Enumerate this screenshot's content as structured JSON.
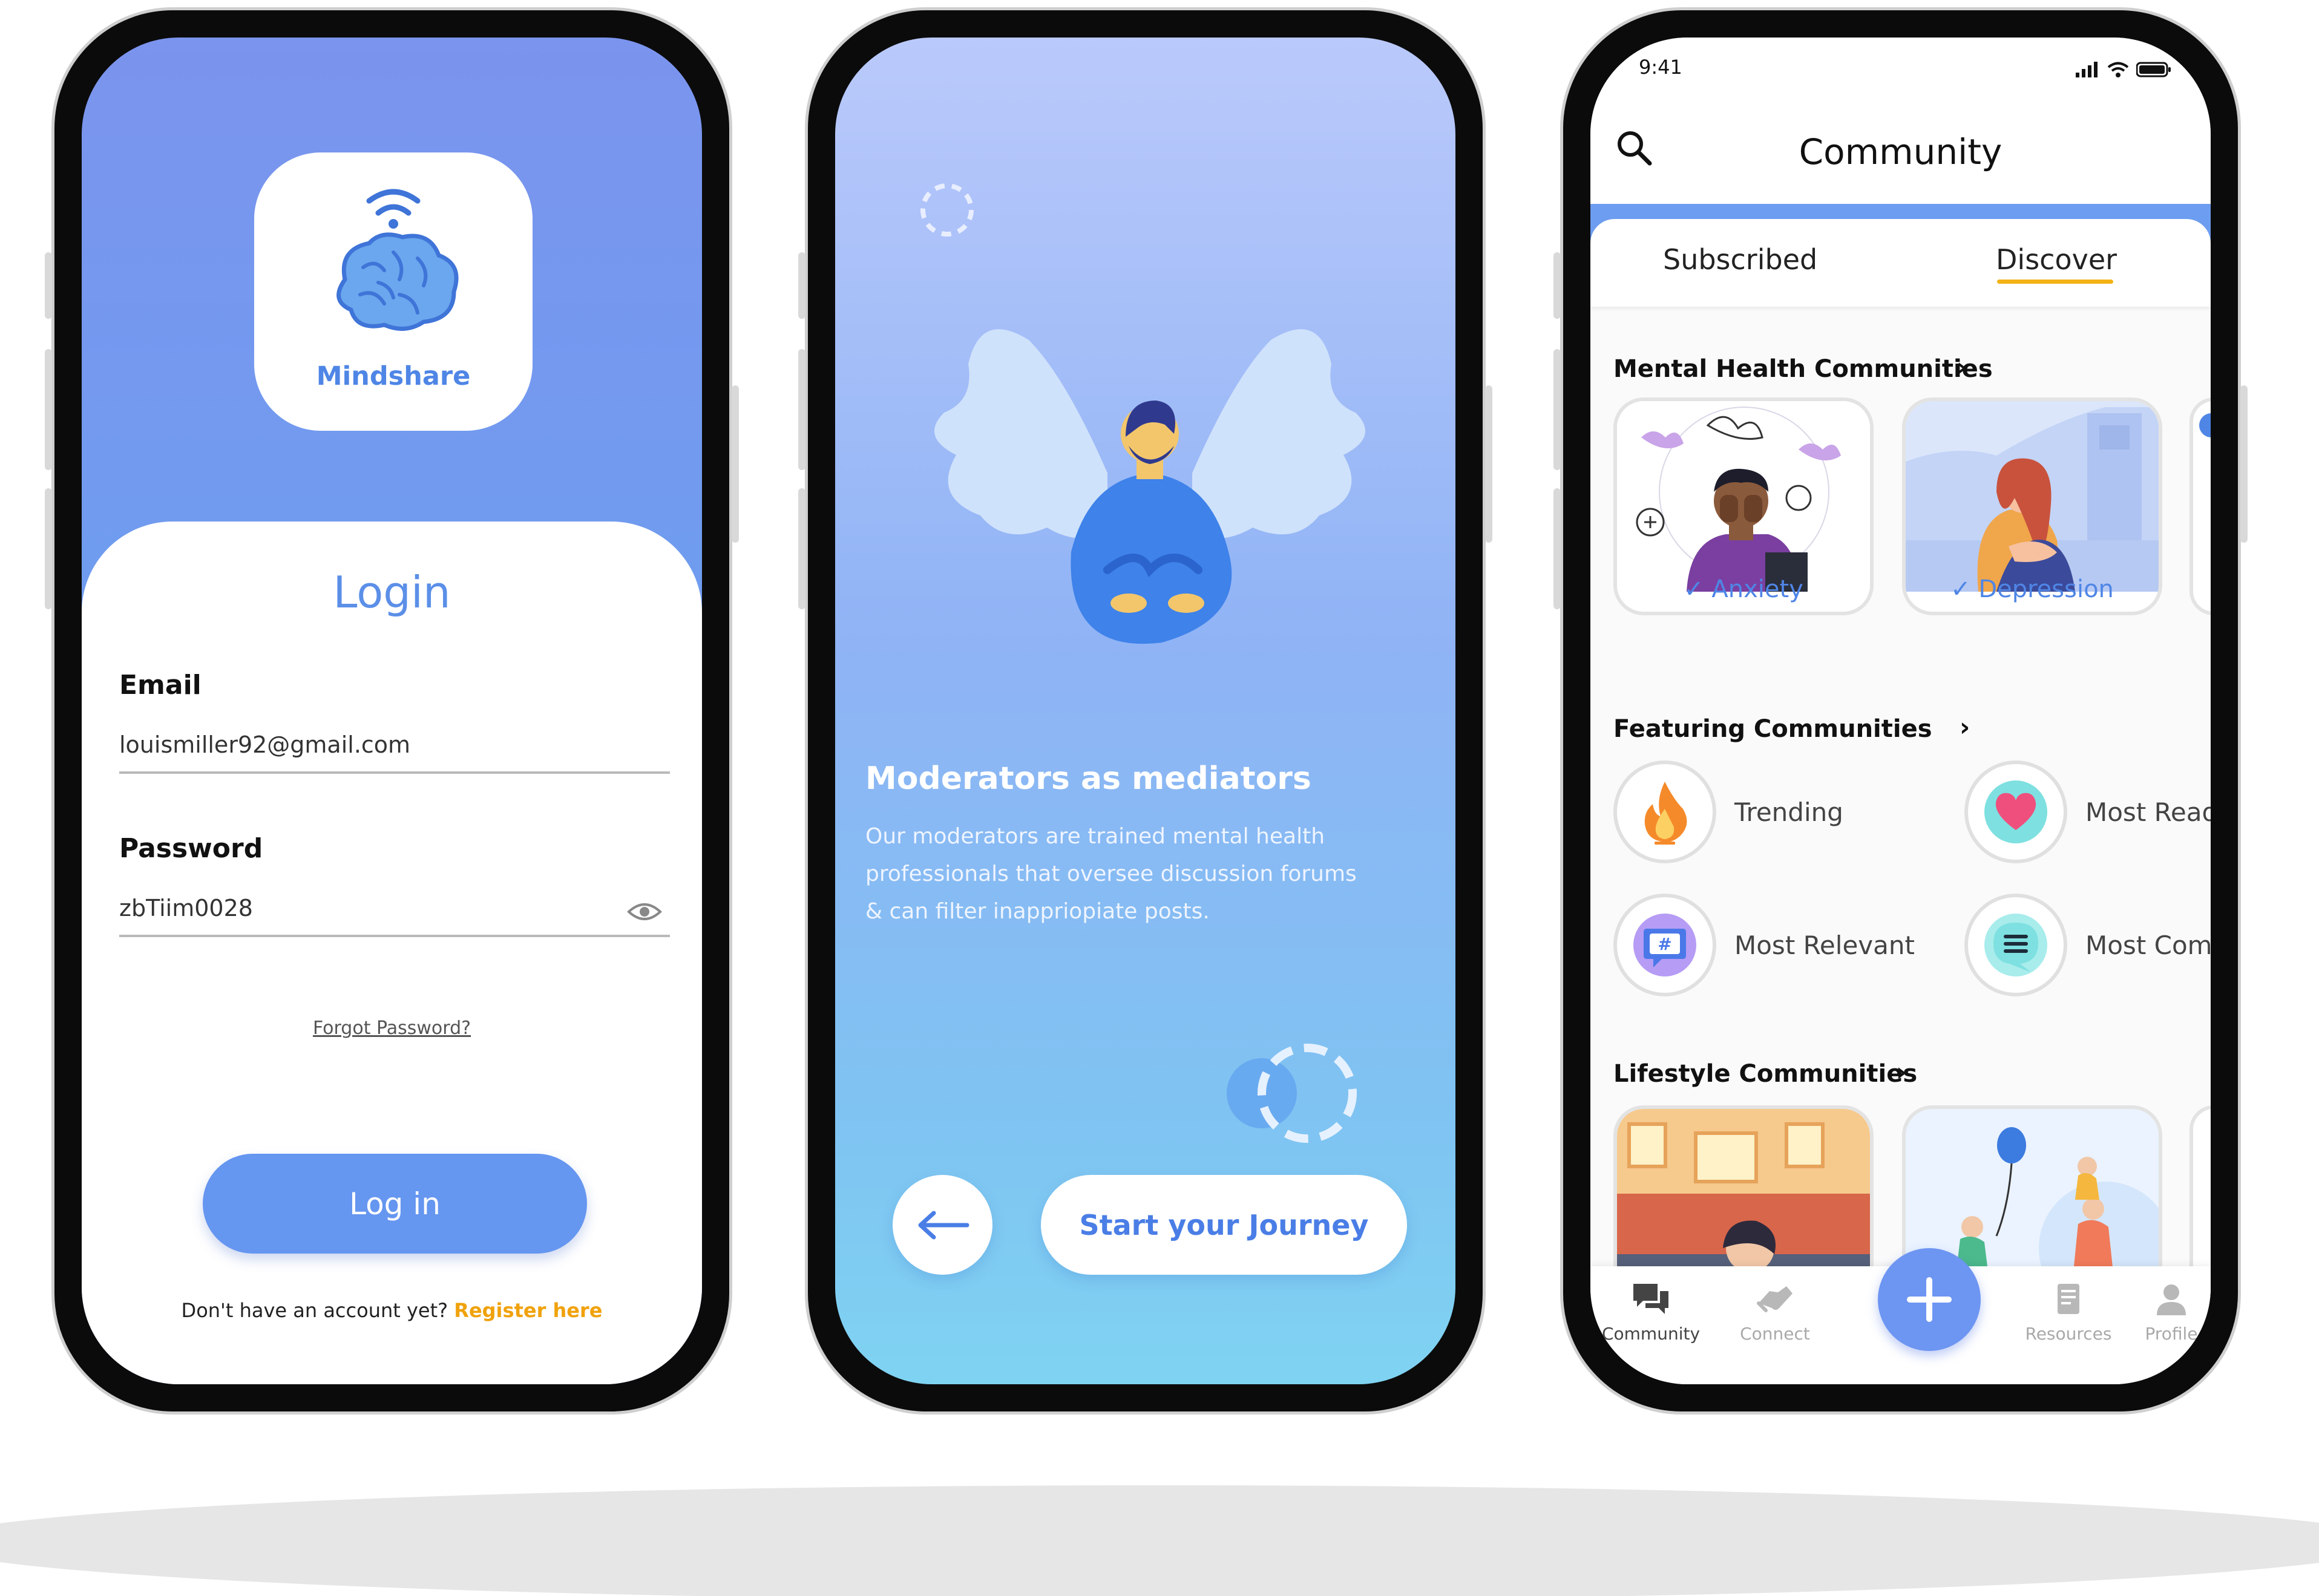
{
  "login": {
    "logo_name": "Mindshare",
    "title": "Login",
    "email_label": "Email",
    "email_value": "louismiller92@gmail.com",
    "password_label": "Password",
    "password_value": "zbTiim0028",
    "forgot_password": "Forgot Password?",
    "login_button": "Log in",
    "no_account_text": "Don't have an account yet?",
    "register_link": "Register here",
    "colors": {
      "primary": "#6596f0",
      "accent": "#f0a20c"
    }
  },
  "onboarding": {
    "title": "Moderators as mediators",
    "body": "Our moderators are trained mental health professionals that oversee discussion forums & can filter inappriopiate posts.",
    "back_icon": "arrow-left-icon",
    "start_button": "Start your Journey"
  },
  "community": {
    "status_time": "9:41",
    "title": "Community",
    "tabs": {
      "subscribed": "Subscribed",
      "discover": "Discover",
      "active": "Discover"
    },
    "mental_health": {
      "title": "Mental Health Communities",
      "cards": [
        {
          "label": "Anxiety"
        },
        {
          "label": "Depression"
        }
      ]
    },
    "featuring": {
      "title": "Featuring Communities",
      "items": [
        {
          "label": "Trending",
          "icon": "fire-icon"
        },
        {
          "label": "Most Read",
          "icon": "heart-icon"
        },
        {
          "label": "Most Relevant",
          "icon": "hashtag-icon"
        },
        {
          "label": "Most Commented",
          "icon": "comment-lines-icon"
        }
      ]
    },
    "lifestyle": {
      "title": "Lifestyle Communities"
    },
    "nav": {
      "community": "Community",
      "connect": "Connect",
      "resources": "Resources",
      "profile": "Profile"
    }
  }
}
